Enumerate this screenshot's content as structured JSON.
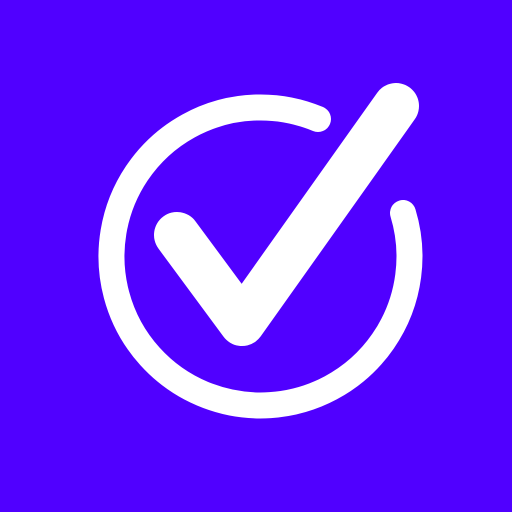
{
  "app_icon": {
    "icon": "check-circle-icon",
    "colors": {
      "background": "#5000FF",
      "glyph": "#FFFFFF"
    }
  }
}
